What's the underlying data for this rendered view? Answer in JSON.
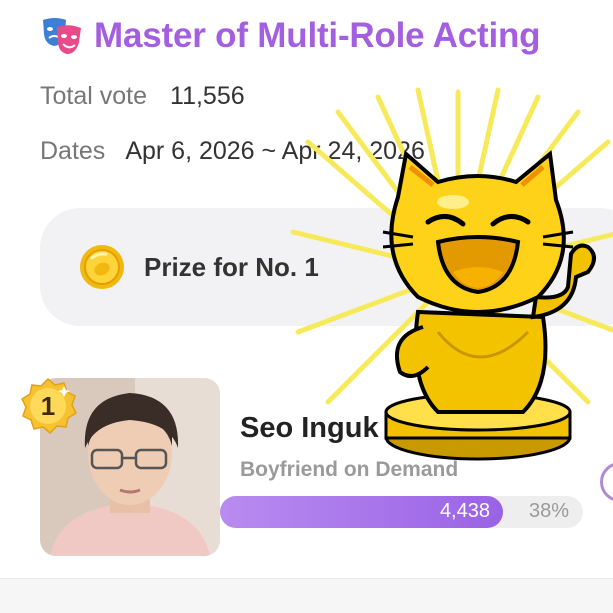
{
  "event": {
    "title": "Master of Multi-Role Acting",
    "icon": "theater-masks-icon",
    "title_color": "#a45fe0"
  },
  "stats": {
    "total_vote_label": "Total vote",
    "total_vote_value": "11,556",
    "dates_label": "Dates",
    "dates_value": "Apr 6, 2026 ~ Apr 24, 2026"
  },
  "prize": {
    "label": "Prize for No. 1",
    "icon": "gold-coin-icon",
    "trophy_icon": "golden-cat-trophy-icon"
  },
  "ranking": [
    {
      "rank": "1",
      "name": "Seo Inguk",
      "show": "Boyfriend on Demand",
      "votes": "4,438",
      "percent": "38%",
      "fraction": 0.78,
      "bar_color": "#9a62e6"
    }
  ]
}
